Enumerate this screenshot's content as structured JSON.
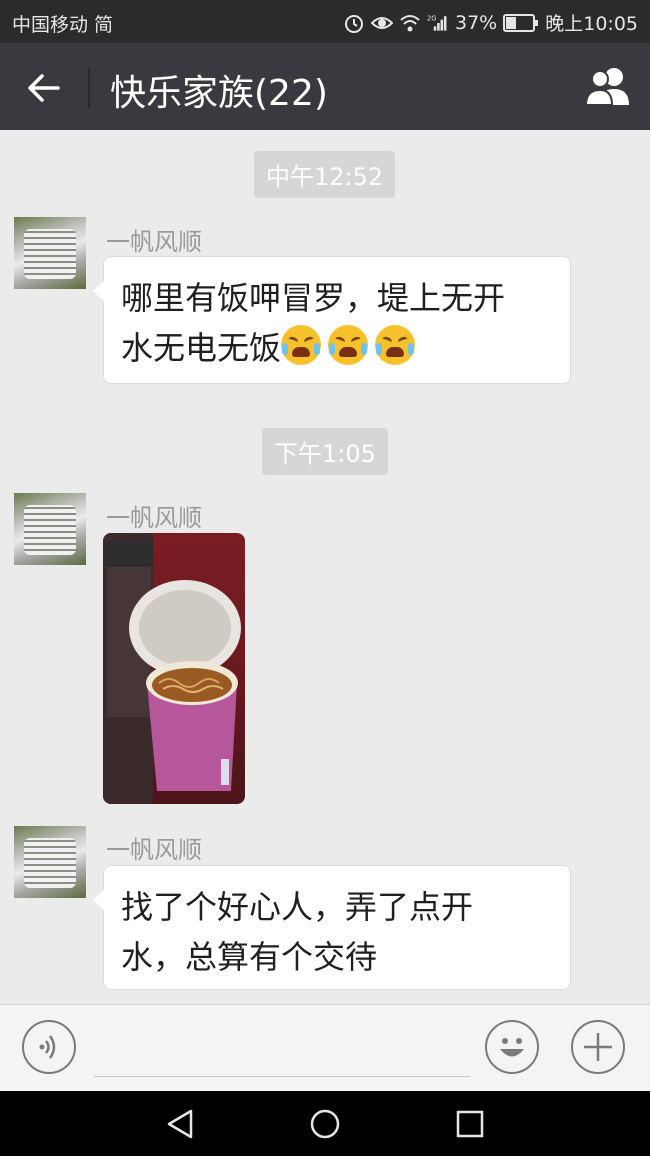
{
  "status_bar": {
    "carrier": "中国移动 简",
    "battery": "37%",
    "time": "晚上10:05",
    "network": "2G"
  },
  "header": {
    "title": "快乐家族(22)"
  },
  "messages": [
    {
      "time": "中午12:52",
      "sender": "一帆风顺",
      "text_line1": "哪里有饭呷冒罗，堤上无开",
      "text_line2": "水无电无饭"
    },
    {
      "time": "下午1:05",
      "sender": "一帆风顺",
      "type": "image"
    },
    {
      "sender": "一帆风顺",
      "text_line1": "找了个好心人，弄了点开",
      "text_line2": "水，总算有个交待"
    }
  ],
  "colors": {
    "titlebar": "#393a3f",
    "statusbar": "#2b2b2b",
    "chat_bg": "#ebebeb"
  },
  "icons": [
    "back-arrow-icon",
    "group-members-icon",
    "voice-icon",
    "emoji-icon",
    "plus-icon",
    "nav-back-icon",
    "nav-home-icon",
    "nav-recent-icon"
  ]
}
